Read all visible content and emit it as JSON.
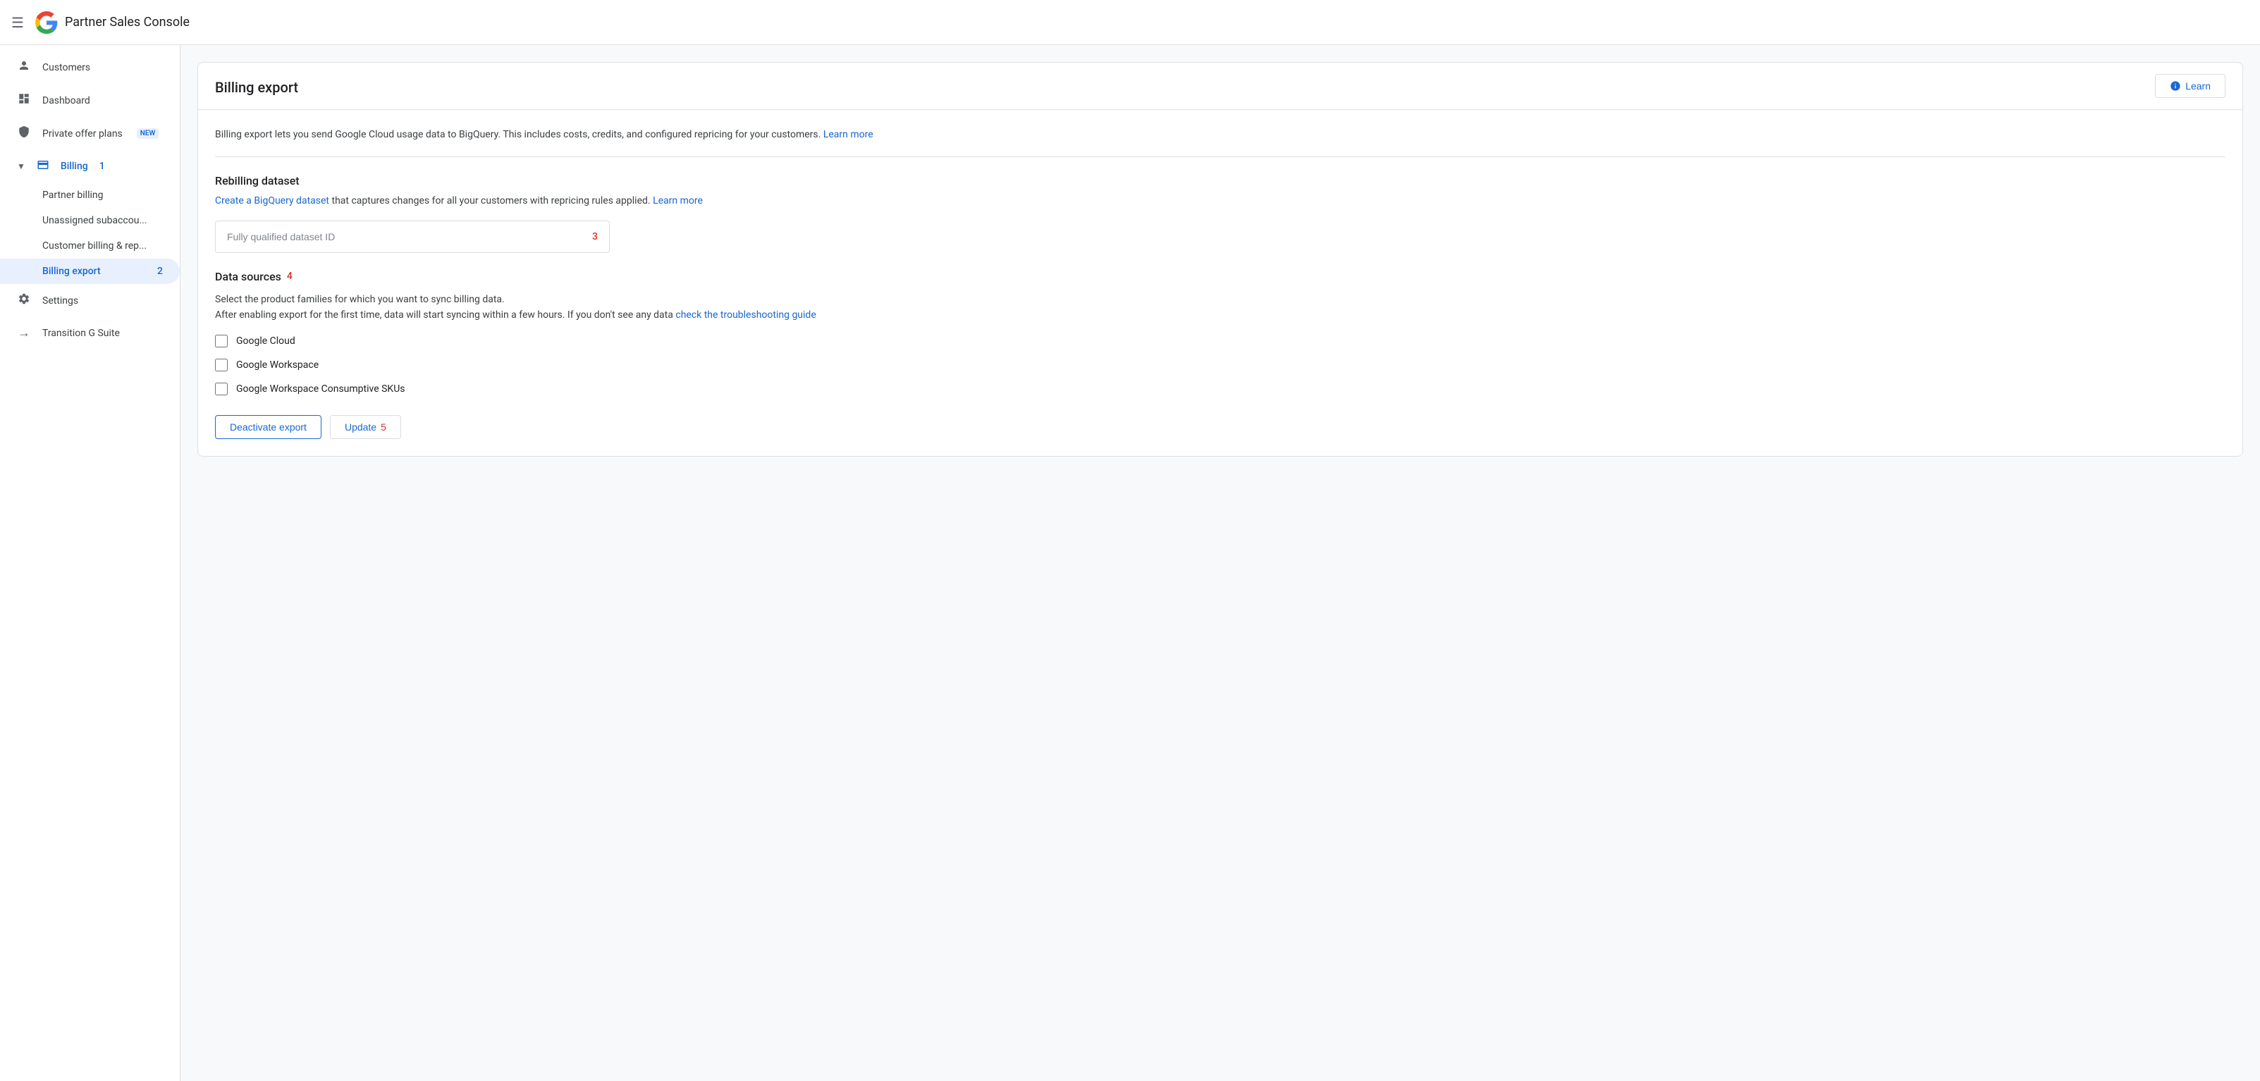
{
  "app": {
    "title": "Partner Sales Console"
  },
  "sidebar": {
    "items": [
      {
        "id": "customers",
        "label": "Customers",
        "icon": "👤",
        "active": false
      },
      {
        "id": "dashboard",
        "label": "Dashboard",
        "icon": "📊",
        "active": false
      },
      {
        "id": "private-offer-plans",
        "label": "Private offer plans",
        "badge": "NEW",
        "icon": "⚙",
        "active": false
      },
      {
        "id": "billing",
        "label": "Billing",
        "icon": "💳",
        "active": true,
        "badge_count": "1"
      },
      {
        "id": "partner-billing",
        "label": "Partner billing",
        "sub": true,
        "active": false
      },
      {
        "id": "unassigned-subaccou",
        "label": "Unassigned subaccou...",
        "sub": true,
        "active": false
      },
      {
        "id": "customer-billing-rep",
        "label": "Customer billing & rep...",
        "sub": true,
        "active": false
      },
      {
        "id": "billing-export",
        "label": "Billing export",
        "sub": true,
        "active": true,
        "badge_count": "2"
      },
      {
        "id": "settings",
        "label": "Settings",
        "icon": "⚙",
        "active": false
      },
      {
        "id": "transition-g-suite",
        "label": "Transition G Suite",
        "icon": "→",
        "active": false
      }
    ]
  },
  "main": {
    "page_title": "Billing export",
    "description": "Billing export lets you send Google Cloud usage data to BigQuery. This includes costs, credits, and configured repricing for your customers.",
    "learn_more_link": "Learn more",
    "learn_button": "Learn",
    "rebilling_section": {
      "title": "Rebilling dataset",
      "description_before": "Create a BigQuery dataset",
      "description_after": "that captures changes for all your customers with repricing rules applied.",
      "learn_more_link": "Learn more",
      "dataset_id_placeholder": "Fully qualified dataset ID",
      "counter": "3"
    },
    "data_sources_section": {
      "title": "Data sources",
      "counter": "4",
      "description_line1": "Select the product families for which you want to sync billing data.",
      "description_line2": "After enabling export for the first time, data will start syncing within a few hours. If you don't see any data",
      "troubleshoot_link": "check the troubleshooting guide",
      "checkboxes": [
        {
          "id": "google-cloud",
          "label": "Google Cloud",
          "checked": false
        },
        {
          "id": "google-workspace",
          "label": "Google Workspace",
          "checked": false
        },
        {
          "id": "google-workspace-consumptive",
          "label": "Google Workspace Consumptive SKUs",
          "checked": false
        }
      ]
    },
    "buttons": {
      "deactivate": "Deactivate export",
      "update": "Update",
      "update_counter": "5"
    }
  }
}
